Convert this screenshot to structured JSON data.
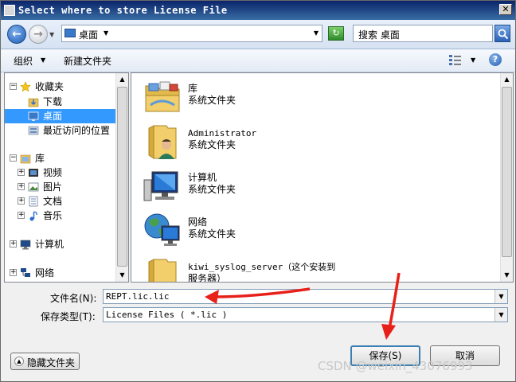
{
  "window": {
    "title": "Select where to store License File",
    "close_label": "✕"
  },
  "address": {
    "back_label": "←",
    "forward_label": "→",
    "location": "桌面",
    "refresh_label": "↻",
    "search_placeholder": "搜索 桌面"
  },
  "toolbar": {
    "organize_label": "组织",
    "new_folder_label": "新建文件夹",
    "help_label": "?"
  },
  "sidebar": {
    "items": [
      {
        "label": "收藏夹",
        "icon": "star-icon",
        "expander": "⊟"
      },
      {
        "label": "下载",
        "icon": "download-folder-icon"
      },
      {
        "label": "桌面",
        "icon": "desktop-icon",
        "selected": true
      },
      {
        "label": "最近访问的位置",
        "icon": "recent-places-icon"
      },
      {
        "label": "库",
        "icon": "library-icon",
        "expander": "⊟"
      },
      {
        "label": "视频",
        "icon": "video-library-icon",
        "expander": "⊞"
      },
      {
        "label": "图片",
        "icon": "pictures-library-icon",
        "expander": "⊞"
      },
      {
        "label": "文档",
        "icon": "documents-library-icon",
        "expander": "⊞"
      },
      {
        "label": "音乐",
        "icon": "music-library-icon",
        "expander": "⊞"
      },
      {
        "label": "计算机",
        "icon": "computer-icon",
        "expander": "⊞"
      },
      {
        "label": "网络",
        "icon": "network-icon",
        "expander": "⊞"
      }
    ]
  },
  "files": [
    {
      "name": "库",
      "type": "系统文件夹",
      "icon": "library-folder-icon"
    },
    {
      "name": "Administrator",
      "type": "系统文件夹",
      "icon": "user-folder-icon"
    },
    {
      "name": "计算机",
      "type": "系统文件夹",
      "icon": "computer-icon"
    },
    {
      "name": "网络",
      "type": "系统文件夹",
      "icon": "network-icon"
    },
    {
      "name": "kiwi_syslog_server（这个安装到",
      "type": "服务器）",
      "icon": "folder-icon"
    }
  ],
  "form": {
    "filename_label": "文件名(N):",
    "filename_value": "REPT.lic.lic",
    "filetype_label": "保存类型(T):",
    "filetype_value": "License Files  ( *.lic )"
  },
  "buttons": {
    "hide_folders": "隐藏文件夹",
    "save": "保存(S)",
    "cancel": "取消"
  },
  "watermark": "CSDN @weixin_43076993",
  "colors": {
    "selection": "#3399ff",
    "annotation": "#e8201a",
    "title_bar": "#0a246a"
  }
}
